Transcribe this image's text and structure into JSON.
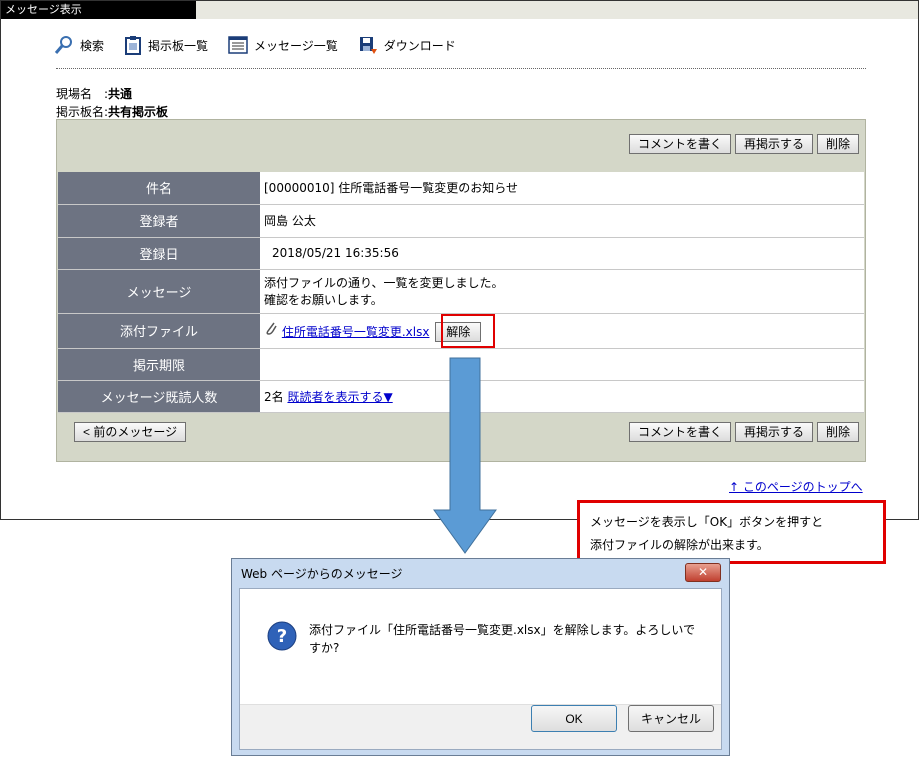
{
  "window": {
    "title": "メッセージ表示"
  },
  "toolbar": {
    "search": "検索",
    "board_list": "掲示板一覧",
    "message_list": "メッセージ一覧",
    "download": "ダウンロード"
  },
  "meta": {
    "site_label": "現場名　:",
    "site_value": "共通",
    "board_label": "掲示板名:",
    "board_value": "共有掲示板"
  },
  "buttons": {
    "comment": "コメントを書く",
    "repost": "再掲示する",
    "delete": "削除",
    "prev": "< 前のメッセージ"
  },
  "rows": {
    "subject_label": "件名",
    "subject_value": "[00000010]  住所電話番号一覧変更のお知らせ",
    "registrant_label": "登録者",
    "registrant_value": "岡島  公太",
    "date_label": "登録日",
    "date_value": "2018/05/21 16:35:56",
    "message_label": "メッセージ",
    "message_line1": "添付ファイルの通り、一覧を変更しました。",
    "message_line2": "確認をお願いします。",
    "attach_label": "添付ファイル",
    "attach_file": "住所電話番号一覧変更.xlsx",
    "attach_remove": "解除",
    "period_label": "掲示期限",
    "period_value": "",
    "readers_label": "メッセージ既読人数",
    "readers_count": "2名",
    "readers_link": "既読者を表示する▼"
  },
  "to_top": "↑ このページのトップへ",
  "callout": {
    "line1": "メッセージを表示し「OK」ボタンを押すと",
    "line2": "添付ファイルの解除が出来ます。"
  },
  "dialog": {
    "title": "Web ページからのメッセージ",
    "close": "✕",
    "message": "添付ファイル「住所電話番号一覧変更.xlsx」を解除します。よろしいですか?",
    "ok": "OK",
    "cancel": "キャンセル"
  },
  "colors": {
    "arrow": "#5b9bd5",
    "highlight": "#e00000",
    "label_bg": "#6d7382",
    "panel_bg": "#d4d7c8"
  }
}
